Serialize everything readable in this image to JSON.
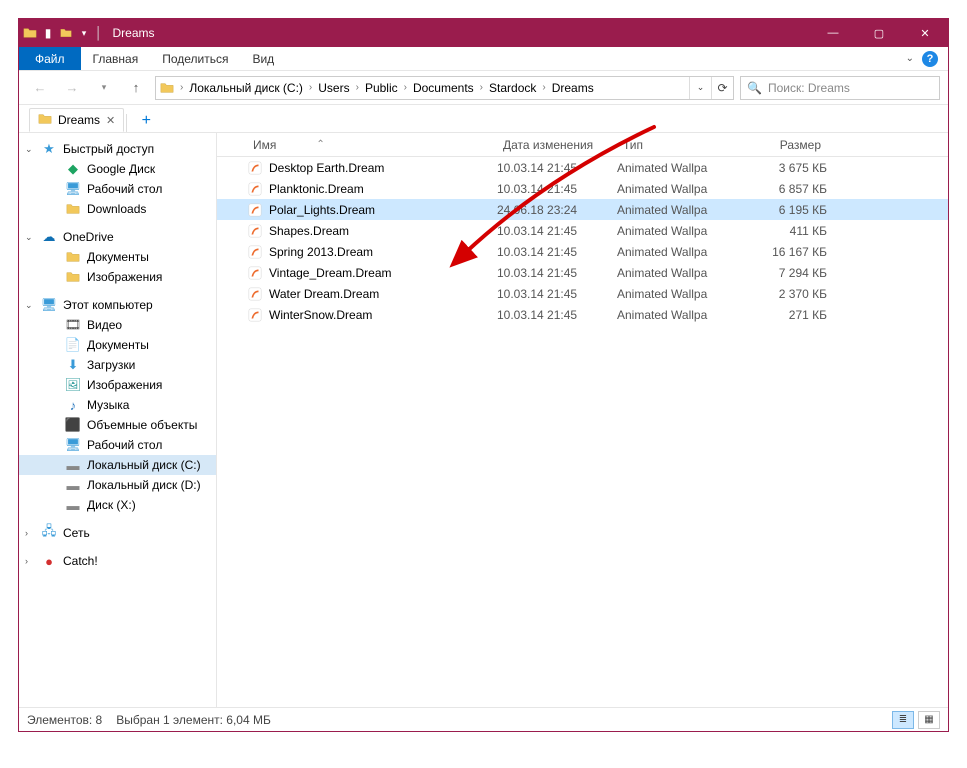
{
  "window": {
    "title": "Dreams"
  },
  "ribbon": {
    "file": "Файл",
    "tabs": [
      "Главная",
      "Поделиться",
      "Вид"
    ]
  },
  "breadcrumb": {
    "segments": [
      "Локальный диск (C:)",
      "Users",
      "Public",
      "Documents",
      "Stardock",
      "Dreams"
    ]
  },
  "search": {
    "placeholder": "Поиск: Dreams"
  },
  "doc_tab": {
    "label": "Dreams"
  },
  "tree": {
    "quick_access": {
      "label": "Быстрый доступ",
      "children": [
        {
          "label": "Google Диск",
          "icon": "gdrive"
        },
        {
          "label": "Рабочий стол",
          "icon": "desktop"
        },
        {
          "label": "Downloads",
          "icon": "folder"
        }
      ]
    },
    "onedrive": {
      "label": "OneDrive",
      "children": [
        {
          "label": "Документы",
          "icon": "folder"
        },
        {
          "label": "Изображения",
          "icon": "folder"
        }
      ]
    },
    "this_pc": {
      "label": "Этот компьютер",
      "children": [
        {
          "label": "Видео",
          "icon": "video"
        },
        {
          "label": "Документы",
          "icon": "docs"
        },
        {
          "label": "Загрузки",
          "icon": "downloads"
        },
        {
          "label": "Изображения",
          "icon": "pictures"
        },
        {
          "label": "Музыка",
          "icon": "music"
        },
        {
          "label": "Объемные объекты",
          "icon": "objects3d"
        },
        {
          "label": "Рабочий стол",
          "icon": "desktop"
        },
        {
          "label": "Локальный диск (C:)",
          "icon": "disk",
          "selected": true
        },
        {
          "label": "Локальный диск (D:)",
          "icon": "disk"
        },
        {
          "label": "Диск (X:)",
          "icon": "disk"
        }
      ]
    },
    "network": {
      "label": "Сеть"
    },
    "catch": {
      "label": "Catch!"
    }
  },
  "columns": {
    "name": "Имя",
    "date": "Дата изменения",
    "type": "Тип",
    "size": "Размер"
  },
  "files": [
    {
      "name": "Desktop Earth.Dream",
      "date": "10.03.14 21:45",
      "type": "Animated Wallpa",
      "size": "3 675 КБ"
    },
    {
      "name": "Planktonic.Dream",
      "date": "10.03.14 21:45",
      "type": "Animated Wallpa",
      "size": "6 857 КБ"
    },
    {
      "name": "Polar_Lights.Dream",
      "date": "24.06.18 23:24",
      "type": "Animated Wallpa",
      "size": "6 195 КБ",
      "selected": true
    },
    {
      "name": "Shapes.Dream",
      "date": "10.03.14 21:45",
      "type": "Animated Wallpa",
      "size": "411 КБ"
    },
    {
      "name": "Spring 2013.Dream",
      "date": "10.03.14 21:45",
      "type": "Animated Wallpa",
      "size": "16 167 КБ"
    },
    {
      "name": "Vintage_Dream.Dream",
      "date": "10.03.14 21:45",
      "type": "Animated Wallpa",
      "size": "7 294 КБ"
    },
    {
      "name": "Water Dream.Dream",
      "date": "10.03.14 21:45",
      "type": "Animated Wallpa",
      "size": "2 370 КБ"
    },
    {
      "name": "WinterSnow.Dream",
      "date": "10.03.14 21:45",
      "type": "Animated Wallpa",
      "size": "271 КБ"
    }
  ],
  "status": {
    "count": "Элементов: 8",
    "selection": "Выбран 1 элемент: 6,04 МБ"
  }
}
